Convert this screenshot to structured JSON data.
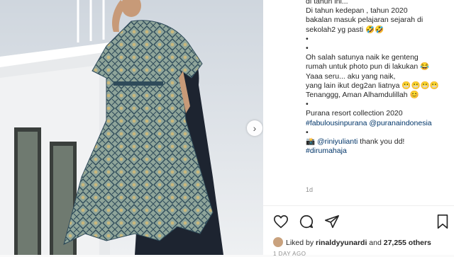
{
  "post": {
    "caption_lines": [
      {
        "text": "di tahun ini...",
        "type": "text"
      },
      {
        "text": "Di tahun kedepan , tahun 2020",
        "type": "text"
      },
      {
        "text": "bakalan masuk pelajaran sejarah di",
        "type": "text"
      },
      {
        "text": "sekolah2 yg pasti 🤣🤣",
        "type": "text"
      },
      {
        "text": "•",
        "type": "text"
      },
      {
        "text": "•",
        "type": "text"
      },
      {
        "text": "Oh salah satunya naik ke genteng",
        "type": "text"
      },
      {
        "text": "rumah untuk photo pun di lakukan 😂",
        "type": "text"
      },
      {
        "text": "Yaaa seru... aku yang naik,",
        "type": "text"
      },
      {
        "text": "yang lain ikut deg2an liatnya 😬😬😬😬",
        "type": "text"
      },
      {
        "text": "Tenanggg, Aman Alhamdulillah 😊",
        "type": "text"
      },
      {
        "text": "•",
        "type": "text"
      },
      {
        "text": "Purana resort collection 2020",
        "type": "text"
      },
      {
        "text": "#fabulousinpurana @puranaindonesia",
        "type": "link"
      },
      {
        "text": "•",
        "type": "text"
      },
      {
        "text": "📸 @riniyulianti thank you dd!",
        "type": "mixed"
      },
      {
        "text": "#dirumahaja",
        "type": "link"
      }
    ],
    "timestamp": "1d",
    "likes_prefix": "Liked by ",
    "liked_by_user": "rinaldyyunardi",
    "likes_mid": " and ",
    "likes_count": "27,255 others",
    "date_label": "1 DAY AGO"
  },
  "icons": {
    "like": "heart-icon",
    "comment": "comment-icon",
    "share": "share-icon",
    "save": "bookmark-icon",
    "next": "chevron-right-icon"
  },
  "colors": {
    "text": "#262626",
    "link": "#003569",
    "muted": "#8e8e8e",
    "background": "#ffffff"
  }
}
